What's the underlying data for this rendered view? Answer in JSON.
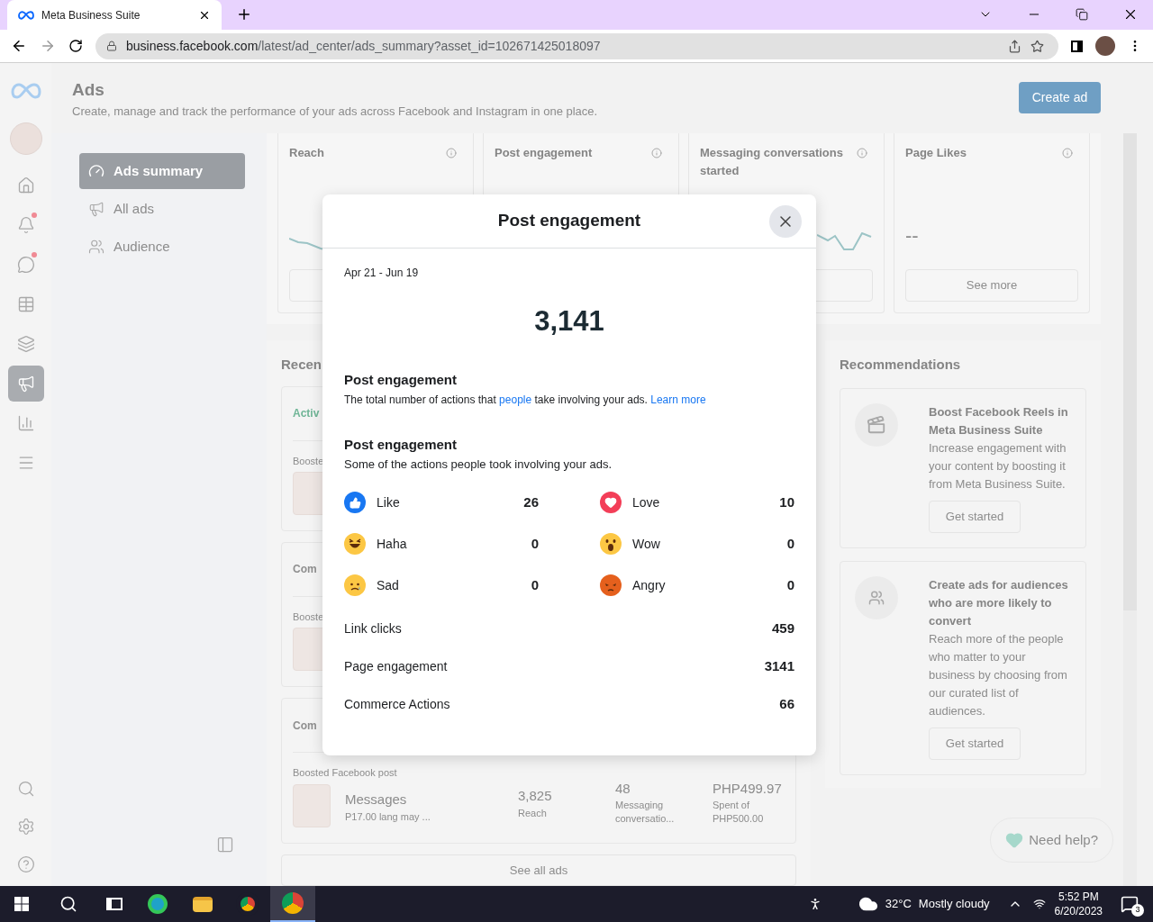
{
  "browser": {
    "tab_title": "Meta Business Suite",
    "url_host": "business.facebook.com",
    "url_path": "/latest/ad_center/ads_summary?asset_id=102671425018097"
  },
  "rail": [
    {
      "kind": "home",
      "selected": false,
      "badge": false
    },
    {
      "kind": "bell",
      "selected": false,
      "badge": true
    },
    {
      "kind": "chat",
      "selected": false,
      "badge": true
    },
    {
      "kind": "calendar",
      "selected": false,
      "badge": false
    },
    {
      "kind": "pages",
      "selected": false,
      "badge": false
    },
    {
      "kind": "megaphone",
      "selected": true,
      "badge": false
    },
    {
      "kind": "chart",
      "selected": false,
      "badge": false
    },
    {
      "kind": "menu",
      "selected": false,
      "badge": false
    }
  ],
  "rail_bottom": [
    {
      "kind": "search"
    },
    {
      "kind": "settings"
    },
    {
      "kind": "help"
    }
  ],
  "header": {
    "title": "Ads",
    "subtitle": "Create, manage and track the performance of your ads across Facebook and Instagram in one place.",
    "button": "Create ad"
  },
  "nav": [
    {
      "kind": "gauge",
      "label": "Ads summary",
      "selected": true
    },
    {
      "kind": "megaphone",
      "label": "All ads",
      "selected": false
    },
    {
      "kind": "people",
      "label": "Audience",
      "selected": false
    }
  ],
  "metrics": [
    {
      "label": "Reach",
      "kind": "sparkline"
    },
    {
      "label": "Post engagement",
      "kind": "plain"
    },
    {
      "label": "Messaging conversations started",
      "kind": "sparkline"
    },
    {
      "label": "Page Likes",
      "kind": "empty",
      "value": "--",
      "button": "See more"
    }
  ],
  "recent": {
    "title": "Recen",
    "cards": [
      {
        "status": "Activ",
        "color": "#6fb596",
        "type": "Booste"
      },
      {
        "status": "Com",
        "color": "#8f8f8f",
        "type": "Booste"
      },
      {
        "status": "Com",
        "color": "#8f8f8f",
        "type": "Boosted Facebook post",
        "name": "Messages",
        "caption": "P17.00 lang may ...",
        "reach": "3,825",
        "reach_label": "Reach",
        "messages": "48",
        "messages_label": "Messaging conversatio...",
        "spent": "PHP499.97",
        "spent_label": "Spent of PHP500.00"
      }
    ],
    "see_all": "See all ads"
  },
  "recommendations": {
    "title": "Recommendations",
    "items": [
      {
        "kind": "reels",
        "title": "Boost Facebook Reels in Meta Business Suite",
        "body": "Increase engagement with your content by boosting it from Meta Business Suite.",
        "button": "Get started"
      },
      {
        "kind": "people",
        "title": "Create ads for audiences who are more likely to convert",
        "body": "Reach more of the people who matter to your business by choosing from our curated list of audiences.",
        "button": "Get started"
      }
    ]
  },
  "help": "Need help?",
  "modal": {
    "title": "Post engagement",
    "date": "Apr 21 - Jun 19",
    "total": "3,141",
    "definition_title": "Post engagement",
    "definition": "The total number of actions that ",
    "definition_link": "people",
    "definition_rest": " take involving your ads. ",
    "learn_more": "Learn more",
    "breakdown_title": "Post engagement",
    "breakdown_subtitle": "Some of the actions people took involving your ads.",
    "reactions": [
      {
        "kind": "like",
        "label": "Like",
        "value": "26"
      },
      {
        "kind": "love",
        "label": "Love",
        "value": "10"
      },
      {
        "kind": "haha",
        "label": "Haha",
        "value": "0"
      },
      {
        "kind": "wow",
        "label": "Wow",
        "value": "0"
      },
      {
        "kind": "sad",
        "label": "Sad",
        "value": "0"
      },
      {
        "kind": "angry",
        "label": "Angry",
        "value": "0"
      }
    ],
    "rows": [
      {
        "label": "Link clicks",
        "value": "459"
      },
      {
        "label": "Page engagement",
        "value": "3141"
      },
      {
        "label": "Commerce Actions",
        "value": "66"
      }
    ]
  },
  "taskbar": {
    "temperature": "32°C",
    "weather": "Mostly cloudy",
    "time": "5:52 PM",
    "date": "6/20/2023",
    "notifications": "3"
  }
}
